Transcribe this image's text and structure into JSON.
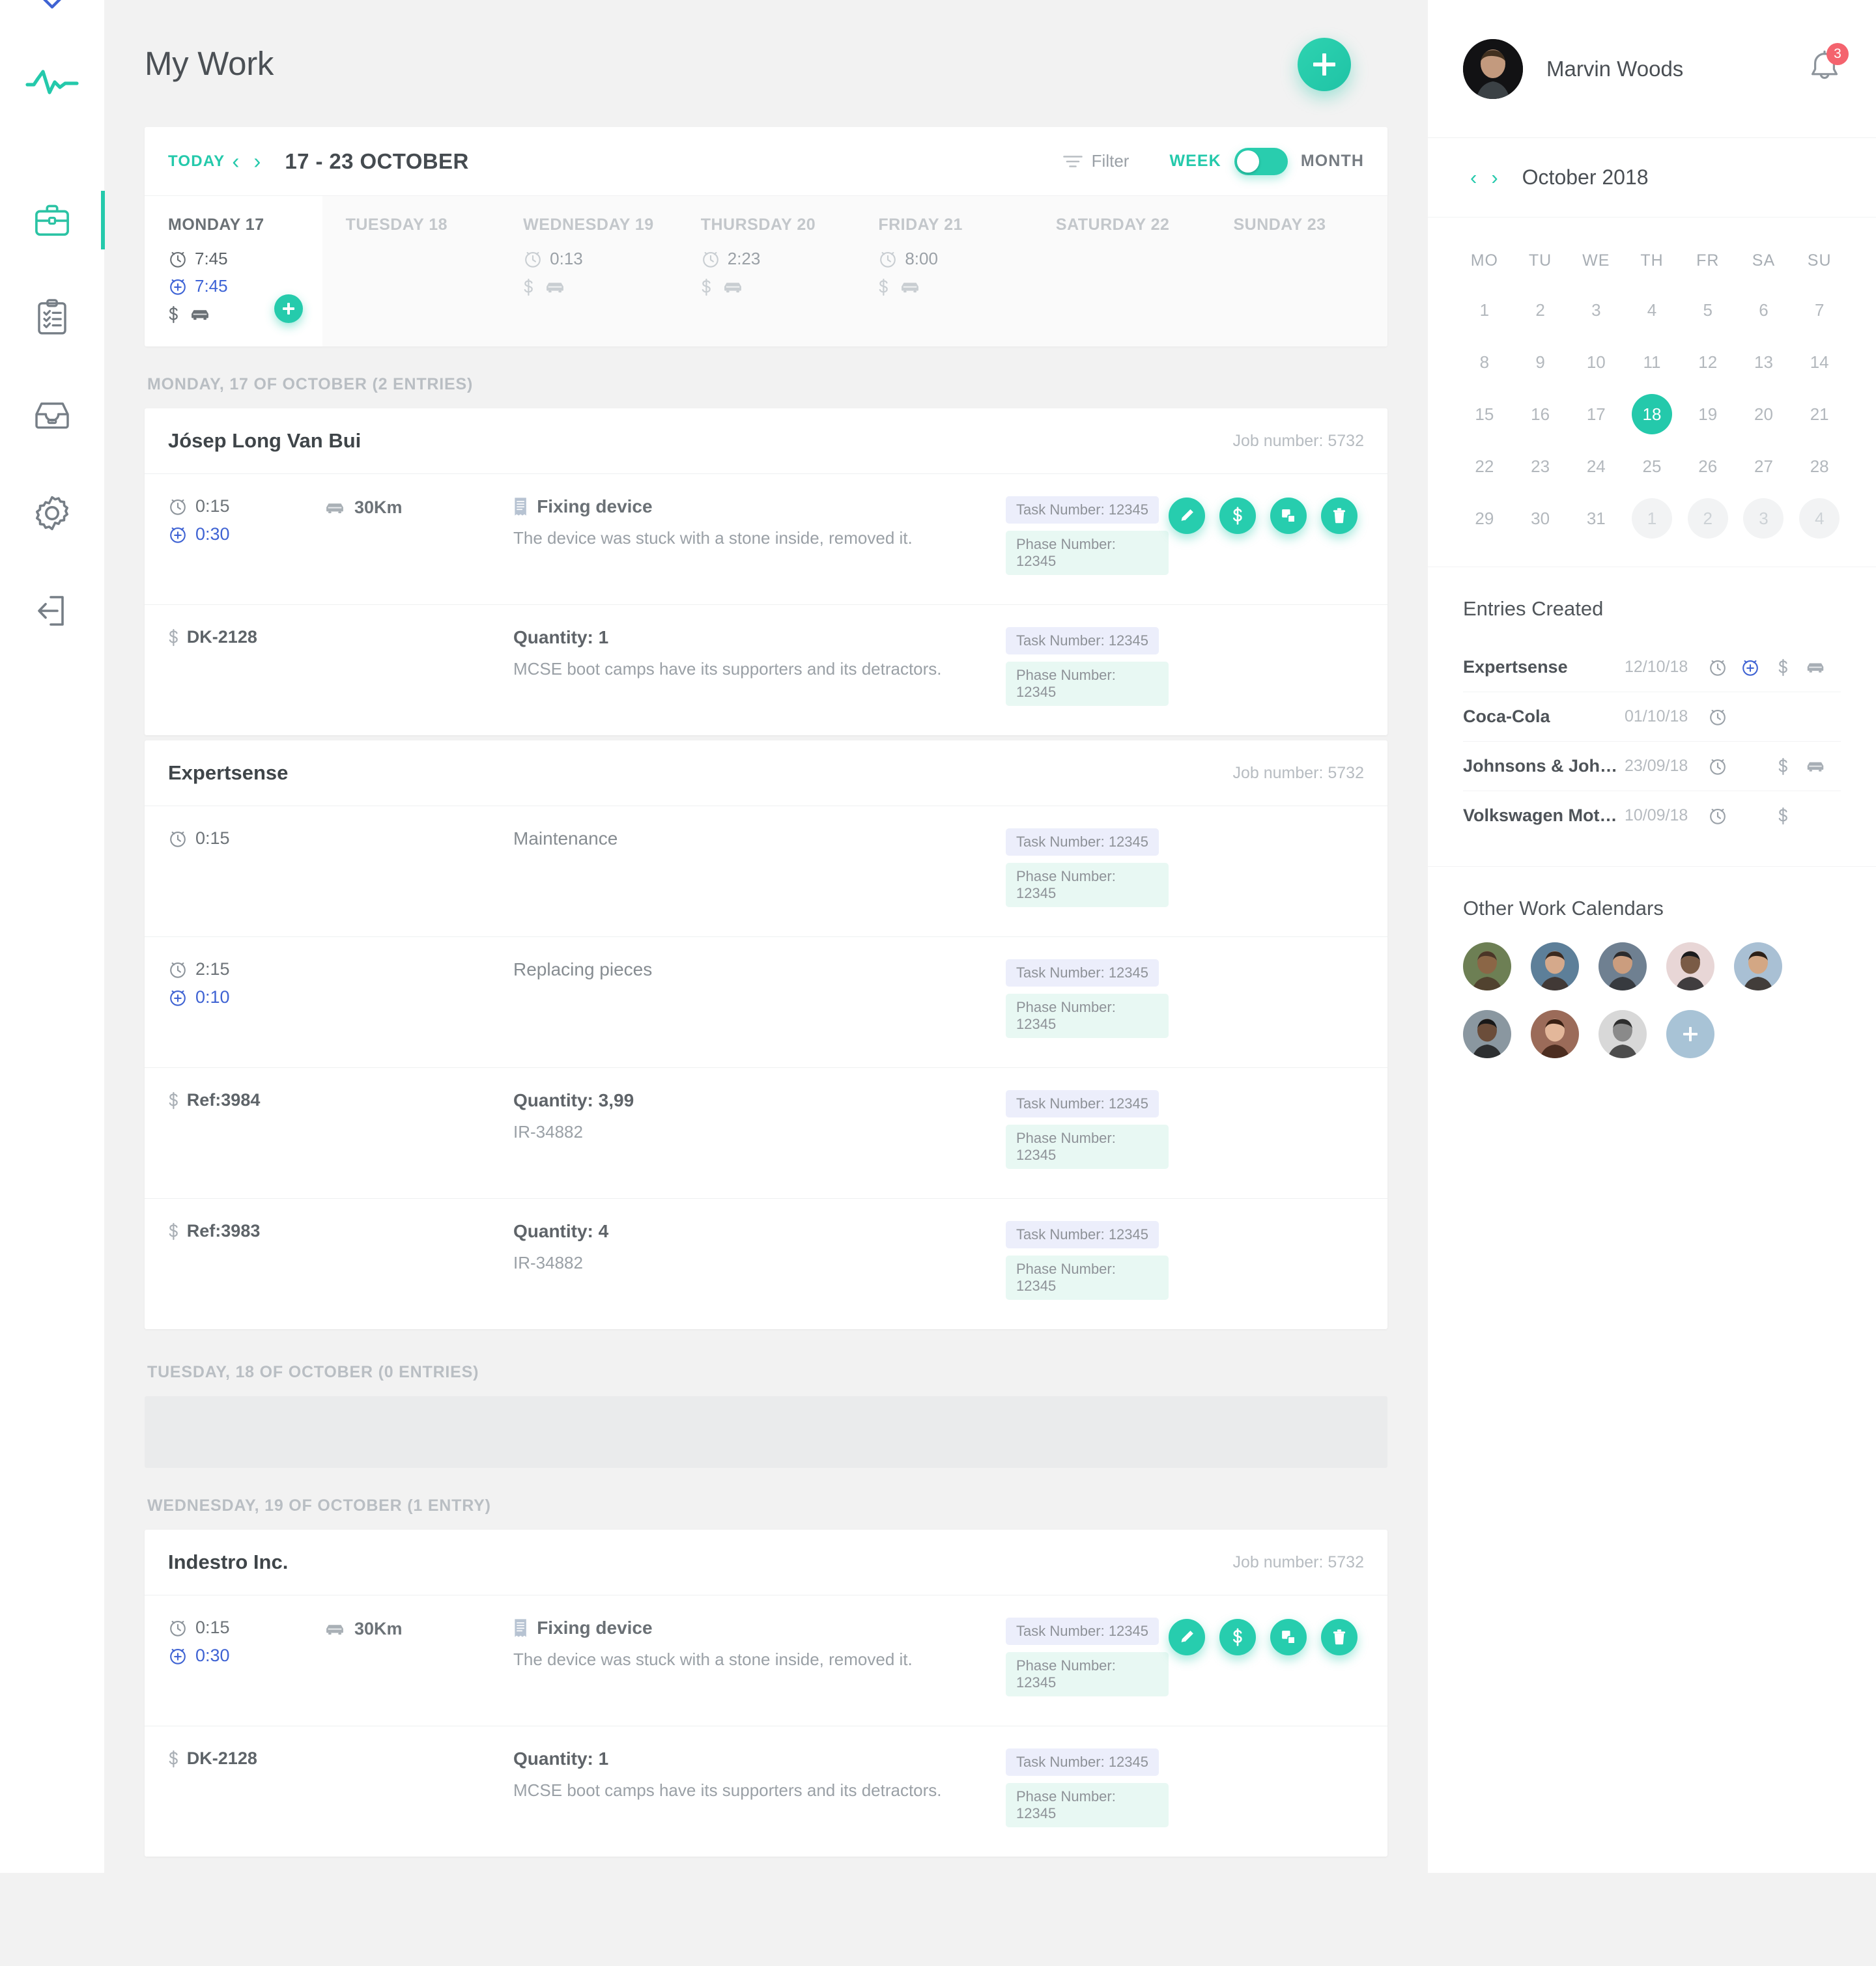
{
  "sidebar": {
    "items": [
      {
        "icon": "pulse-logo-icon",
        "name": "logo"
      },
      {
        "icon": "briefcase-icon",
        "name": "my-work",
        "active": true
      },
      {
        "icon": "clipboard-checklist-icon",
        "name": "tasks"
      },
      {
        "icon": "inbox-tray-icon",
        "name": "archive"
      },
      {
        "icon": "gear-icon",
        "name": "settings"
      },
      {
        "icon": "logout-icon",
        "name": "logout"
      }
    ]
  },
  "header": {
    "title": "My Work",
    "add_button": "+"
  },
  "toolbar": {
    "today_label": "TODAY",
    "prev_arrow": "‹",
    "next_arrow": "›",
    "range_label": "17 - 23 OCTOBER",
    "filter_label": "Filter",
    "week_label": "WEEK",
    "month_label": "MONTH",
    "toggle_state": "week"
  },
  "week_days": [
    {
      "name": "MONDAY 17",
      "active": true,
      "time": "7:45",
      "extra_time": "7:45",
      "has_money": true,
      "has_car": true,
      "add_button": "+"
    },
    {
      "name": "TUESDAY 18",
      "active": false,
      "time": "",
      "extra_time": "",
      "has_money": false,
      "has_car": false
    },
    {
      "name": "WEDNESDAY 19",
      "active": false,
      "time": "0:13",
      "extra_time": "",
      "has_money": true,
      "has_car": true
    },
    {
      "name": "THURSDAY 20",
      "active": false,
      "time": "2:23",
      "extra_time": "",
      "has_money": true,
      "has_car": true
    },
    {
      "name": "FRIDAY 21",
      "active": false,
      "time": "8:00",
      "extra_time": "",
      "has_money": true,
      "has_car": true
    },
    {
      "name": "SATURDAY 22",
      "active": false,
      "time": "",
      "extra_time": "",
      "has_money": false,
      "has_car": false
    },
    {
      "name": "SUNDAY 23",
      "active": false,
      "time": "",
      "extra_time": "",
      "has_money": false,
      "has_car": false
    }
  ],
  "groups": [
    {
      "header": "MONDAY, 17 OF OCTOBER (2 ENTRIES)",
      "empty": false,
      "cards": [
        {
          "title": "Jósep Long Van Bui",
          "job_label": "Job number: 5732",
          "rows": [
            {
              "type": "time",
              "time": "0:15",
              "extra_time": "0:30",
              "km": "30Km",
              "desc_title": "Fixing device",
              "desc_sub": "The device was stuck with a stone inside, removed it.",
              "task_badge": "Task Number: 12345",
              "phase_badge": "Phase Number: 12345",
              "actions": [
                "edit-icon",
                "dollar-icon",
                "copy-icon",
                "trash-icon"
              ]
            },
            {
              "type": "expense",
              "ref": "DK-2128",
              "desc_strong": "Quantity: 1",
              "desc_sub": "MCSE boot camps have its supporters and its detractors.",
              "task_badge": "Task Number: 12345",
              "phase_badge": "Phase Number: 12345",
              "actions": []
            }
          ]
        },
        {
          "title": "Expertsense",
          "job_label": "Job number: 5732",
          "rows": [
            {
              "type": "time",
              "time": "0:15",
              "extra_time": "",
              "km": "",
              "desc_plain": "Maintenance",
              "task_badge": "Task Number: 12345",
              "phase_badge": "Phase Number: 12345",
              "actions": []
            },
            {
              "type": "time",
              "time": "2:15",
              "extra_time": "0:10",
              "km": "",
              "desc_plain": "Replacing pieces",
              "task_badge": "Task Number: 12345",
              "phase_badge": "Phase Number: 12345",
              "actions": []
            },
            {
              "type": "expense",
              "ref": "Ref:3984",
              "desc_strong": "Quantity: 3,99",
              "desc_sub": "IR-34882",
              "task_badge": "Task Number: 12345",
              "phase_badge": "Phase Number: 12345",
              "actions": []
            },
            {
              "type": "expense",
              "ref": "Ref:3983",
              "desc_strong": "Quantity: 4",
              "desc_sub": "IR-34882",
              "task_badge": "Task Number: 12345",
              "phase_badge": "Phase Number: 12345",
              "actions": []
            }
          ]
        }
      ]
    },
    {
      "header": "TUESDAY, 18 OF OCTOBER (0 ENTRIES)",
      "empty": true,
      "cards": []
    },
    {
      "header": "WEDNESDAY, 19 OF OCTOBER (1 ENTRY)",
      "empty": false,
      "cards": [
        {
          "title": "Indestro Inc.",
          "job_label": "Job number: 5732",
          "rows": [
            {
              "type": "time",
              "time": "0:15",
              "extra_time": "0:30",
              "km": "30Km",
              "desc_title": "Fixing device",
              "desc_sub": "The device was stuck with a stone inside, removed it.",
              "task_badge": "Task Number: 12345",
              "phase_badge": "Phase Number: 12345",
              "actions": [
                "edit-icon",
                "dollar-icon",
                "copy-icon",
                "trash-icon"
              ]
            },
            {
              "type": "expense",
              "ref": "DK-2128",
              "desc_strong": "Quantity: 1",
              "desc_sub": "MCSE boot camps have its supporters and its detractors.",
              "task_badge": "Task Number: 12345",
              "phase_badge": "Phase Number: 12345",
              "actions": []
            }
          ]
        }
      ]
    }
  ],
  "right_panel": {
    "user_name": "Marvin Woods",
    "notification_count": "3",
    "calendar": {
      "prev_arrow": "‹",
      "next_arrow": "›",
      "month_label": "October 2018",
      "dow": [
        "MO",
        "TU",
        "WE",
        "TH",
        "FR",
        "SA",
        "SU"
      ],
      "weeks": [
        [
          {
            "d": "1"
          },
          {
            "d": "2"
          },
          {
            "d": "3"
          },
          {
            "d": "4"
          },
          {
            "d": "5"
          },
          {
            "d": "6"
          },
          {
            "d": "7"
          }
        ],
        [
          {
            "d": "8"
          },
          {
            "d": "9"
          },
          {
            "d": "10"
          },
          {
            "d": "11"
          },
          {
            "d": "12"
          },
          {
            "d": "13"
          },
          {
            "d": "14"
          }
        ],
        [
          {
            "d": "15"
          },
          {
            "d": "16"
          },
          {
            "d": "17"
          },
          {
            "d": "18",
            "sel": true
          },
          {
            "d": "19"
          },
          {
            "d": "20"
          },
          {
            "d": "21"
          }
        ],
        [
          {
            "d": "22"
          },
          {
            "d": "23"
          },
          {
            "d": "24"
          },
          {
            "d": "25"
          },
          {
            "d": "26"
          },
          {
            "d": "27"
          },
          {
            "d": "28"
          }
        ],
        [
          {
            "d": "29"
          },
          {
            "d": "30"
          },
          {
            "d": "31"
          },
          {
            "d": "1",
            "muted": true
          },
          {
            "d": "2",
            "muted": true
          },
          {
            "d": "3",
            "muted": true
          },
          {
            "d": "4",
            "muted": true
          }
        ]
      ]
    },
    "entries_created": {
      "title": "Entries Created",
      "items": [
        {
          "name": "Expertsense",
          "date": "12/10/18",
          "icons": [
            "clock",
            "alarm-plus",
            "dollar",
            "car"
          ]
        },
        {
          "name": "Coca-Cola",
          "date": "01/10/18",
          "icons": [
            "clock"
          ]
        },
        {
          "name": "Johnsons & Johns…",
          "date": "23/09/18",
          "icons": [
            "clock",
            "dollar",
            "car"
          ]
        },
        {
          "name": "Volkswagen Motors",
          "date": "10/09/18",
          "icons": [
            "clock",
            "dollar"
          ]
        }
      ]
    },
    "other_calendars": {
      "title": "Other Work Calendars",
      "avatar_count": 8,
      "add_button": "+"
    }
  },
  "colors": {
    "accent": "#24c9ab",
    "badge_red": "#f4636e",
    "blue": "#3f63d3",
    "bg": "#f2f2f2"
  }
}
